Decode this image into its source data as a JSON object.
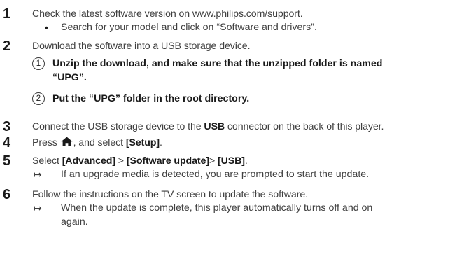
{
  "steps": [
    {
      "number": "1",
      "text": "Check the latest software version on www.philips.com/support.",
      "bullet": "•",
      "bullet_text": "Search for your model and click on “Software and drivers”."
    },
    {
      "number": "2",
      "text": "Download the software into a USB storage device.",
      "substeps": [
        {
          "marker": "1",
          "line1": "Unzip the download, and make sure that the unzipped folder is named",
          "line2": "“UPG”."
        },
        {
          "marker": "2",
          "line1": "Put the “UPG” folder in the root directory."
        }
      ]
    },
    {
      "number": "3",
      "text_before": "Connect the USB storage device to the ",
      "text_bold": "USB",
      "text_after": " connector on the back of this player."
    },
    {
      "number": "4",
      "text_before": "Press ",
      "icon": "home-icon",
      "text_middle": ", and select ",
      "text_bold": "[Setup]",
      "text_after": "."
    },
    {
      "number": "5",
      "bold1": "[Advanced]",
      "bold2": "[Software update]",
      "bold3": "[USB]",
      "text_select": "Select ",
      "sep": " > ",
      "sep2": "> ",
      "text_end": ".",
      "arrow": "↦",
      "result": "If an upgrade media is detected, you are prompted to start the update."
    },
    {
      "number": "6",
      "text": "Follow the instructions on the TV screen to update the software.",
      "arrow": "↦",
      "result_line1": "When the update is complete, this player automatically turns off and on",
      "result_line2": "again."
    }
  ]
}
